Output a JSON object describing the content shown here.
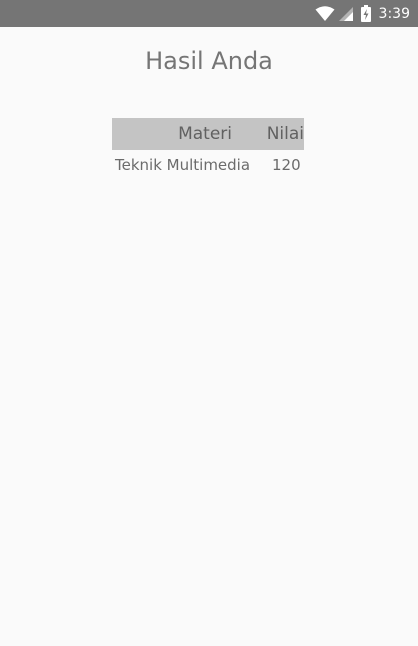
{
  "status_bar": {
    "time": "3:39",
    "icons": [
      "wifi-icon",
      "signal-icon",
      "battery-charging-icon"
    ]
  },
  "page": {
    "title": "Hasil Anda"
  },
  "table": {
    "headers": [
      "Materi",
      "Nilai"
    ],
    "rows": [
      {
        "materi": "Teknik Multimedia",
        "nilai": "120"
      }
    ]
  },
  "colors": {
    "status_bar_bg": "#757575",
    "header_bg": "#c4c4c4",
    "page_bg": "#fafafa"
  }
}
